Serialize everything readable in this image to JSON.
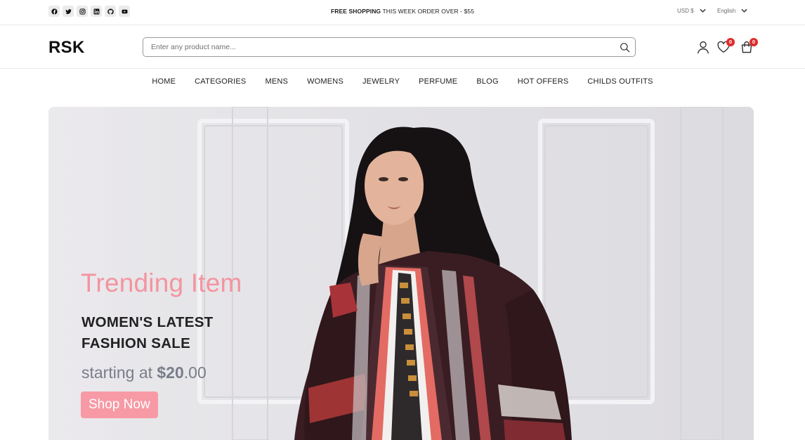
{
  "topbar": {
    "social_icons": [
      "facebook-icon",
      "twitter-icon",
      "instagram-icon",
      "linkedin-icon",
      "github-icon",
      "youtube-icon"
    ],
    "promo_bold": "FREE SHOPPING",
    "promo_rest": " THIS WEEK ORDER OVER - $55",
    "currency": "USD $",
    "language": "English"
  },
  "header": {
    "logo": "RSK",
    "search_placeholder": "Enter any product name...",
    "wishlist_count": "0",
    "cart_count": "0"
  },
  "nav": {
    "items": [
      "HOME",
      "CATEGORIES",
      "MENS",
      "WOMENS",
      "JEWELRY",
      "PERFUME",
      "BLOG",
      "HOT OFFERS",
      "CHILDS OUTFITS"
    ]
  },
  "banner": {
    "subtitle": "Trending Item",
    "title": "WOMEN'S LATEST FASHION SALE",
    "price_prefix": "starting at ",
    "price_bold": "$20",
    "price_suffix": ".00",
    "button": "Shop Now"
  },
  "colors": {
    "accent_pink": "#f4949f",
    "button_pink": "#f79aa5",
    "badge_red": "#e02b2b"
  }
}
